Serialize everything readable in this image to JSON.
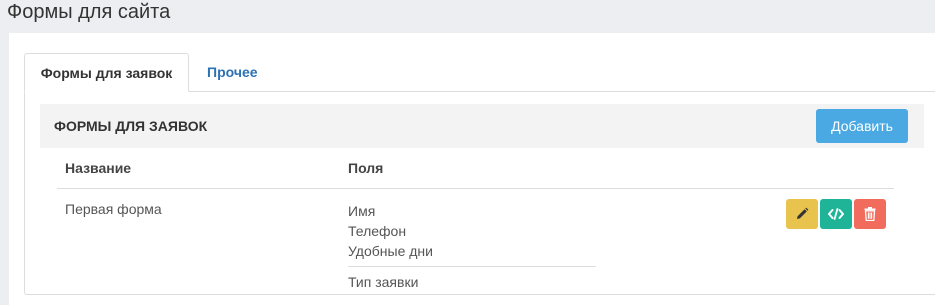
{
  "page": {
    "title": "Формы для сайта"
  },
  "tabs": [
    {
      "label": "Формы для заявок",
      "active": true
    },
    {
      "label": "Прочее",
      "active": false
    }
  ],
  "box": {
    "title": "ФОРМЫ ДЛЯ ЗАЯВОК",
    "add_label": "Добавить"
  },
  "table": {
    "headers": {
      "name": "Название",
      "fields": "Поля"
    },
    "rows": [
      {
        "name": "Первая форма",
        "fields": [
          "Имя",
          "Телефон",
          "Удобные дни"
        ],
        "extra_field": "Тип заявки",
        "actions": [
          "edit-icon",
          "code-icon",
          "trash-icon"
        ]
      }
    ]
  },
  "colors": {
    "accent": "#4aa9e2",
    "edit": "#e8c34e",
    "code": "#1fb398",
    "delete": "#f16c5c",
    "tab_link": "#2d72b4"
  }
}
